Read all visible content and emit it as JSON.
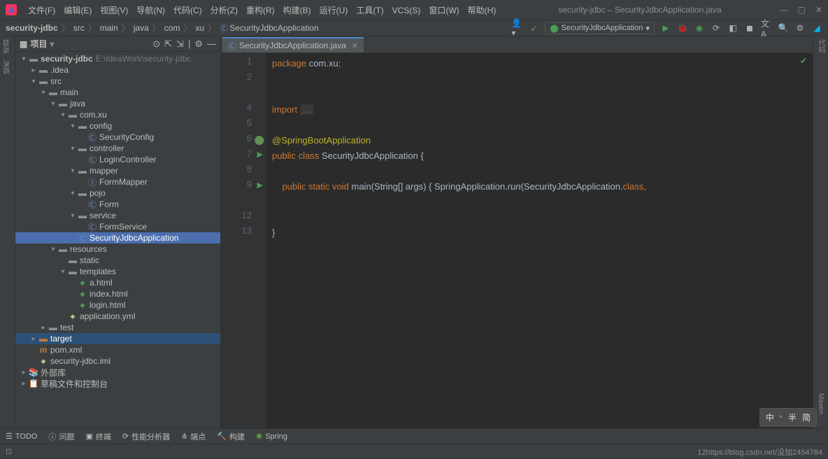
{
  "titlebar": {
    "menus": [
      "文件(F)",
      "编辑(E)",
      "视图(V)",
      "导航(N)",
      "代码(C)",
      "分析(Z)",
      "重构(R)",
      "构建(B)",
      "运行(U)",
      "工具(T)",
      "VCS(S)",
      "窗口(W)",
      "帮助(H)"
    ],
    "title": "security-jdbc – SecurityJdbcApplication.java"
  },
  "breadcrumb": [
    "security-jdbc",
    "src",
    "main",
    "java",
    "com",
    "xu",
    "SecurityJdbcApplication"
  ],
  "run_config": "SecurityJdbcApplication",
  "project_panel": {
    "title": "项目",
    "root": "security-jdbc",
    "root_path": "E:\\IdeaWork\\security-jdbc"
  },
  "tree": [
    {
      "d": 0,
      "arr": "v",
      "icon": "📁",
      "label": "security-jdbc",
      "hint": "E:\\IdeaWork\\security-jdbc",
      "bold": true
    },
    {
      "d": 1,
      "arr": ">",
      "icon": "📁",
      "label": ".idea"
    },
    {
      "d": 1,
      "arr": "v",
      "icon": "📁",
      "label": "src"
    },
    {
      "d": 2,
      "arr": "v",
      "icon": "📁",
      "label": "main"
    },
    {
      "d": 3,
      "arr": "v",
      "icon": "📁",
      "label": "java"
    },
    {
      "d": 4,
      "arr": "v",
      "icon": "📁",
      "label": "com.xu"
    },
    {
      "d": 5,
      "arr": "v",
      "icon": "📁",
      "label": "config"
    },
    {
      "d": 6,
      "arr": "",
      "icon": "Ⓒ",
      "label": "SecurityConfig",
      "cls": "class"
    },
    {
      "d": 5,
      "arr": "v",
      "icon": "📁",
      "label": "controller"
    },
    {
      "d": 6,
      "arr": "",
      "icon": "Ⓒ",
      "label": "LoginController",
      "cls": "class"
    },
    {
      "d": 5,
      "arr": "v",
      "icon": "📁",
      "label": "mapper"
    },
    {
      "d": 6,
      "arr": "",
      "icon": "Ⓘ",
      "label": "FormMapper",
      "cls": "class"
    },
    {
      "d": 5,
      "arr": "v",
      "icon": "📁",
      "label": "pojo"
    },
    {
      "d": 6,
      "arr": "",
      "icon": "Ⓒ",
      "label": "Form",
      "cls": "class"
    },
    {
      "d": 5,
      "arr": "v",
      "icon": "📁",
      "label": "service"
    },
    {
      "d": 6,
      "arr": "",
      "icon": "Ⓒ",
      "label": "FormService",
      "cls": "class"
    },
    {
      "d": 5,
      "arr": "",
      "icon": "Ⓒ",
      "label": "SecurityJdbcApplication",
      "cls": "class",
      "selected": true
    },
    {
      "d": 3,
      "arr": "v",
      "icon": "📁",
      "label": "resources"
    },
    {
      "d": 4,
      "arr": "",
      "icon": "📁",
      "label": "static"
    },
    {
      "d": 4,
      "arr": "v",
      "icon": "📁",
      "label": "templates"
    },
    {
      "d": 5,
      "arr": "",
      "icon": "◆",
      "label": "a.html",
      "cls": "html"
    },
    {
      "d": 5,
      "arr": "",
      "icon": "◆",
      "label": "index.html",
      "cls": "html"
    },
    {
      "d": 5,
      "arr": "",
      "icon": "◆",
      "label": "login.html",
      "cls": "html"
    },
    {
      "d": 4,
      "arr": "",
      "icon": "◆",
      "label": "application.yml",
      "cls": "yml"
    },
    {
      "d": 2,
      "arr": ">",
      "icon": "📁",
      "label": "test"
    },
    {
      "d": 1,
      "arr": ">",
      "icon": "📁",
      "label": "target",
      "highlight": true,
      "orange": true
    },
    {
      "d": 1,
      "arr": "",
      "icon": "m",
      "label": "pom.xml"
    },
    {
      "d": 1,
      "arr": "",
      "icon": "◆",
      "label": "security-jdbc.iml"
    },
    {
      "d": 0,
      "arr": ">",
      "icon": "📚",
      "label": "外部库"
    },
    {
      "d": 0,
      "arr": ">",
      "icon": "📋",
      "label": "草稿文件和控制台"
    }
  ],
  "tab": {
    "label": "SecurityJdbcApplication.java"
  },
  "code_lines": {
    "l1": "package",
    "l1b": "com.xu",
    "l1c": ";",
    "l4": "import",
    "l4b": "...",
    "l6": "@SpringBootApplication",
    "l7a": "public",
    "l7b": "class",
    "l7c": "SecurityJdbcApplication {",
    "l9a": "public",
    "l9b": "static",
    "l9c": "void",
    "l9d": "main",
    "l9e": "(String[] args) { SpringApplication.",
    "l9f": "run",
    "l9g": "(SecurityJdbcApplication.",
    "l9h": "class",
    "l9i": ",",
    "l13": "}"
  },
  "line_numbers": [
    "1",
    "2",
    "",
    "4",
    "5",
    "6",
    "7",
    "8",
    "9",
    "",
    "12",
    "13"
  ],
  "bottom_tabs": [
    "TODO",
    "问题",
    "终端",
    "性能分析器",
    "端点",
    "构建",
    "Spring"
  ],
  "status": {
    "right": "12https://blog.csdn.net/没加2454784"
  },
  "ime": [
    "中",
    "◦",
    "半",
    "简"
  ],
  "left_gutter": [
    "项目",
    "结构"
  ],
  "right_gutter_top": "代码",
  "right_gutter_bottom": "Maven"
}
